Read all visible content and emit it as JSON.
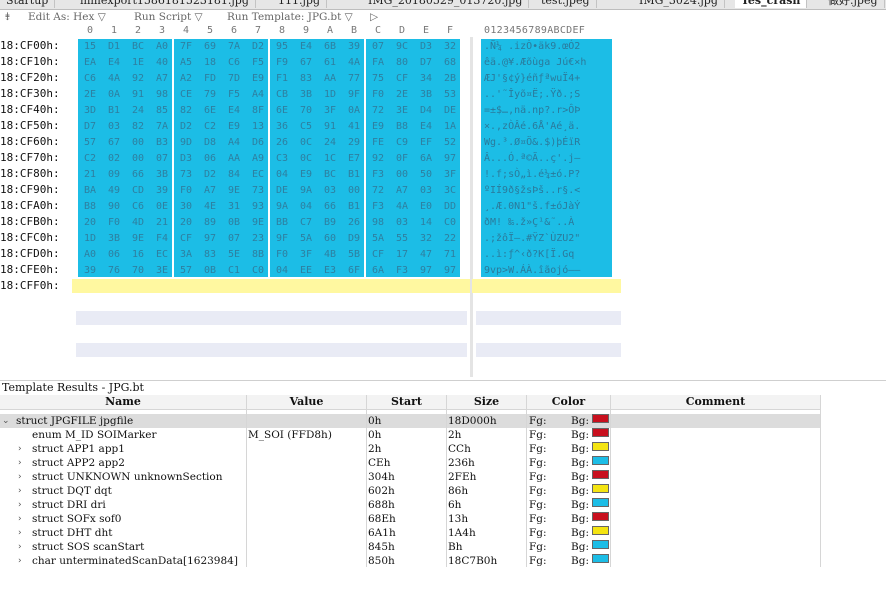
{
  "tabs": [
    {
      "label": "Startup"
    },
    {
      "label": "mmexport1586181523181.jpg"
    },
    {
      "label": "111.jpg"
    },
    {
      "label": "IMG_20180529_013720.jpg"
    },
    {
      "label": "test.jpeg"
    },
    {
      "label": "IMG_3024.jpg"
    },
    {
      "label": "Tes_crash",
      "active": true
    },
    {
      "label": "做好.jpeg"
    }
  ],
  "toolbar": {
    "edit_as": "Edit As: Hex ▽",
    "run_script": "Run Script ▽",
    "run_template": "Run Template: JPG.bt ▽",
    "play": "▷"
  },
  "hex_columns": [
    "0",
    "1",
    "2",
    "3",
    "4",
    "5",
    "6",
    "7",
    "8",
    "9",
    "A",
    "B",
    "C",
    "D",
    "E",
    "F"
  ],
  "ascii_header": "0123456789ABCDEF",
  "rows": [
    {
      "addr": "18:CF00h:",
      "hex": [
        "15",
        "D1",
        "BC",
        "A0",
        "7F",
        "69",
        "7A",
        "D2",
        "95",
        "E4",
        "6B",
        "39",
        "07",
        "9C",
        "D3",
        "32"
      ],
      "ascii": ".Ñ¼ .izÒ•äk9.œÓ2"
    },
    {
      "addr": "18:CF10h:",
      "hex": [
        "EA",
        "E4",
        "1E",
        "40",
        "A5",
        "18",
        "C6",
        "F5",
        "F9",
        "67",
        "61",
        "4A",
        "FA",
        "80",
        "D7",
        "68"
      ],
      "ascii": "êä.@¥.Æõùga Jú€×h"
    },
    {
      "addr": "18:CF20h:",
      "hex": [
        "C6",
        "4A",
        "92",
        "A7",
        "A2",
        "FD",
        "7D",
        "E9",
        "F1",
        "83",
        "AA",
        "77",
        "75",
        "CF",
        "34",
        "2B"
      ],
      "ascii": "ÆJ'§¢ý}éñƒªwuÏ4+"
    },
    {
      "addr": "18:CF30h:",
      "hex": [
        "2E",
        "0A",
        "91",
        "98",
        "CE",
        "79",
        "F5",
        "A4",
        "CB",
        "3B",
        "1D",
        "9F",
        "F0",
        "2E",
        "3B",
        "53"
      ],
      "ascii": "..'˜Îyõ¤Ë;.Ÿð.;S"
    },
    {
      "addr": "18:CF40h:",
      "hex": [
        "3D",
        "B1",
        "24",
        "85",
        "82",
        "6E",
        "E4",
        "8F",
        "6E",
        "70",
        "3F",
        "0A",
        "72",
        "3E",
        "D4",
        "DE"
      ],
      "ascii": "=±$…‚nä.np?.r>ÔÞ"
    },
    {
      "addr": "18:CF50h:",
      "hex": [
        "D7",
        "03",
        "82",
        "7A",
        "D2",
        "C2",
        "E9",
        "13",
        "36",
        "C5",
        "91",
        "41",
        "E9",
        "B8",
        "E4",
        "1A"
      ],
      "ascii": "×.‚zÒÂé.6Å'Aé¸ä."
    },
    {
      "addr": "18:CF60h:",
      "hex": [
        "57",
        "67",
        "00",
        "B3",
        "9D",
        "D8",
        "A4",
        "D6",
        "26",
        "0C",
        "24",
        "29",
        "FE",
        "C9",
        "EF",
        "52"
      ],
      "ascii": "Wg.³.Ø¤Ö&.$)þÉïR"
    },
    {
      "addr": "18:CF70h:",
      "hex": [
        "C2",
        "02",
        "00",
        "07",
        "D3",
        "06",
        "AA",
        "A9",
        "C3",
        "0C",
        "1C",
        "E7",
        "92",
        "0F",
        "6A",
        "97"
      ],
      "ascii": "Â...Ó.ª©Ã..ç'.j—"
    },
    {
      "addr": "18:CF80h:",
      "hex": [
        "21",
        "09",
        "66",
        "3B",
        "73",
        "D2",
        "84",
        "EC",
        "04",
        "E9",
        "BC",
        "B1",
        "F3",
        "00",
        "50",
        "3F"
      ],
      "ascii": "!.f;sÒ„ì.é¼±ó.P?"
    },
    {
      "addr": "18:CF90h:",
      "hex": [
        "BA",
        "49",
        "CD",
        "39",
        "F0",
        "A7",
        "9E",
        "73",
        "DE",
        "9A",
        "03",
        "00",
        "72",
        "A7",
        "03",
        "3C"
      ],
      "ascii": "ºIÍ9ð§žsÞš..r§.<"
    },
    {
      "addr": "18:CFA0h:",
      "hex": [
        "B8",
        "90",
        "C6",
        "0E",
        "30",
        "4E",
        "31",
        "93",
        "9A",
        "04",
        "66",
        "B1",
        "F3",
        "4A",
        "E0",
        "DD"
      ],
      "ascii": "¸.Æ.0N1\"š.f±óJàÝ"
    },
    {
      "addr": "18:CFB0h:",
      "hex": [
        "20",
        "F0",
        "4D",
        "21",
        "20",
        "89",
        "0B",
        "9E",
        "BB",
        "C7",
        "B9",
        "26",
        "98",
        "03",
        "14",
        "C0"
      ],
      "ascii": " ðM! ‰.ž»Ç¹&˜..À"
    },
    {
      "addr": "18:CFC0h:",
      "hex": [
        "1D",
        "3B",
        "9E",
        "F4",
        "CF",
        "97",
        "07",
        "23",
        "9F",
        "5A",
        "60",
        "D9",
        "5A",
        "55",
        "32",
        "22"
      ],
      "ascii": ".;žôÏ—.#ŸZ`ÙZU2\""
    },
    {
      "addr": "18:CFD0h:",
      "hex": [
        "A0",
        "06",
        "16",
        "EC",
        "3A",
        "83",
        "5E",
        "8B",
        "F0",
        "3F",
        "4B",
        "5B",
        "CF",
        "17",
        "47",
        "71"
      ],
      "ascii": " ..ì:ƒ^‹ð?K[Ï.Gq"
    },
    {
      "addr": "18:CFE0h:",
      "hex": [
        "39",
        "76",
        "70",
        "3E",
        "57",
        "0B",
        "C1",
        "C0",
        "04",
        "EE",
        "E3",
        "6F",
        "6A",
        "F3",
        "97",
        "97"
      ],
      "ascii": "9vp>W.ÁÀ.îãojó——"
    }
  ],
  "last_row_addr": "18:CFF0h:",
  "template_results": {
    "title": "Template Results - JPG.bt",
    "headers": [
      "Name",
      "Value",
      "Start",
      "Size",
      "Color",
      "Comment"
    ],
    "rows": [
      {
        "toggle": "⌄",
        "name": "struct JPGFILE jpgfile",
        "value": "",
        "start": "0h",
        "size": "18D000h",
        "fg": "Fg:",
        "bg": "Bg:",
        "color": "#c8101e",
        "indent": 0,
        "selected": true
      },
      {
        "toggle": "",
        "name": "enum M_ID SOIMarker",
        "value": "M_SOI (FFD8h)",
        "start": "0h",
        "size": "2h",
        "fg": "Fg:",
        "bg": "Bg:",
        "color": "#c8101e",
        "indent": 1
      },
      {
        "toggle": "›",
        "name": "struct APP1 app1",
        "value": "",
        "start": "2h",
        "size": "CCh",
        "fg": "Fg:",
        "bg": "Bg:",
        "color": "#f4e412",
        "indent": 1
      },
      {
        "toggle": "›",
        "name": "struct APP2 app2",
        "value": "",
        "start": "CEh",
        "size": "236h",
        "fg": "Fg:",
        "bg": "Bg:",
        "color": "#1cbde6",
        "indent": 1
      },
      {
        "toggle": "›",
        "name": "struct UNKNOWN unknownSection",
        "value": "",
        "start": "304h",
        "size": "2FEh",
        "fg": "Fg:",
        "bg": "Bg:",
        "color": "#c8101e",
        "indent": 1
      },
      {
        "toggle": "›",
        "name": "struct DQT dqt",
        "value": "",
        "start": "602h",
        "size": "86h",
        "fg": "Fg:",
        "bg": "Bg:",
        "color": "#f4e412",
        "indent": 1
      },
      {
        "toggle": "›",
        "name": "struct DRI dri",
        "value": "",
        "start": "688h",
        "size": "6h",
        "fg": "Fg:",
        "bg": "Bg:",
        "color": "#1cbde6",
        "indent": 1
      },
      {
        "toggle": "›",
        "name": "struct SOFx sof0",
        "value": "",
        "start": "68Eh",
        "size": "13h",
        "fg": "Fg:",
        "bg": "Bg:",
        "color": "#c8101e",
        "indent": 1
      },
      {
        "toggle": "›",
        "name": "struct DHT dht",
        "value": "",
        "start": "6A1h",
        "size": "1A4h",
        "fg": "Fg:",
        "bg": "Bg:",
        "color": "#f4e412",
        "indent": 1
      },
      {
        "toggle": "›",
        "name": "struct SOS scanStart",
        "value": "",
        "start": "845h",
        "size": "Bh",
        "fg": "Fg:",
        "bg": "Bg:",
        "color": "#1cbde6",
        "indent": 1
      },
      {
        "toggle": "›",
        "name": "char unterminatedScanData[1623984]",
        "value": "",
        "start": "850h",
        "size": "18C7B0h",
        "fg": "Fg:",
        "bg": "Bg:",
        "color": "#1cbde6",
        "indent": 1
      }
    ]
  }
}
